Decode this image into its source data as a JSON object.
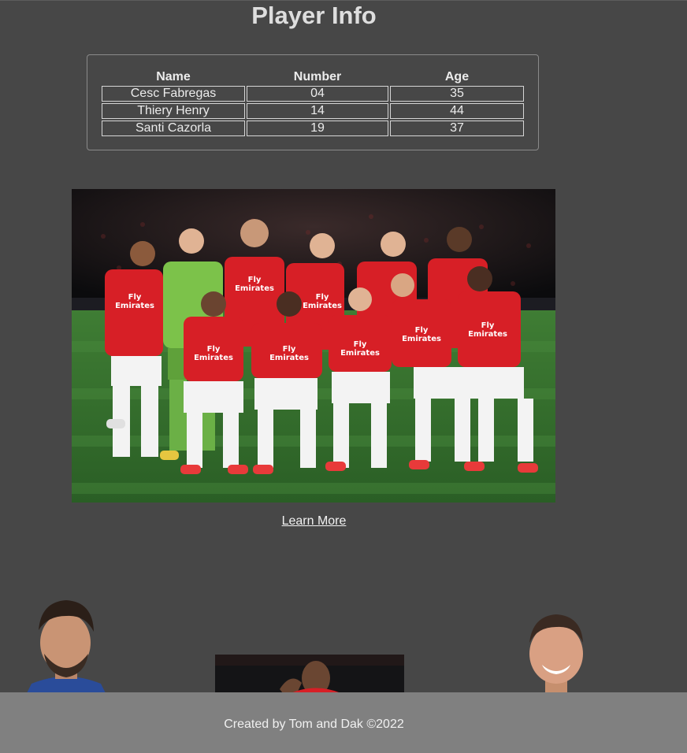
{
  "page": {
    "title": "Player Info"
  },
  "table": {
    "headers": [
      "Name",
      "Number",
      "Age"
    ],
    "rows": [
      [
        "Cesc Fabregas",
        "04",
        "35"
      ],
      [
        "Thiery Henry",
        "14",
        "44"
      ],
      [
        "Santi Cazorla",
        "19",
        "37"
      ]
    ]
  },
  "team_photo": {
    "jersey_sponsor": "Fly Emirates",
    "icon": "team-photo"
  },
  "link": {
    "learn_more": "Learn More"
  },
  "footer": {
    "credit": "Created by Tom and Dak ©2022"
  },
  "colors": {
    "background": "#474747",
    "footer": "#808080",
    "kit_red": "#d71f26",
    "pitch_green": "#2f6b2a",
    "keeper_green": "#7cc24a"
  }
}
